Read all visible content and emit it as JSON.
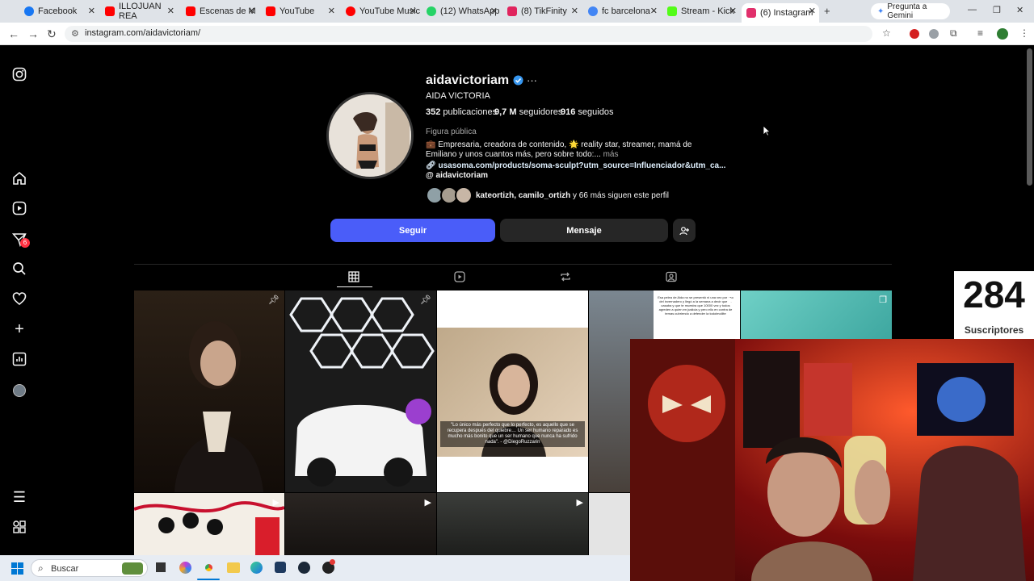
{
  "browser": {
    "tabs": [
      {
        "label": "Facebook",
        "color": "#1877f2"
      },
      {
        "label": "ILLOJUAN REA",
        "color": "#ff0000"
      },
      {
        "label": "Escenas de M",
        "color": "#ff0000"
      },
      {
        "label": "YouTube",
        "color": "#ff0000"
      },
      {
        "label": "YouTube Music",
        "color": "#ff0000"
      },
      {
        "label": "(12) WhatsApp",
        "color": "#25d366"
      },
      {
        "label": "(8) TikFinity",
        "color": "#e0245e"
      },
      {
        "label": "fc barcelona -",
        "color": "#4285f4"
      },
      {
        "label": "Stream - Kick",
        "color": "#53fc18"
      },
      {
        "label": "(6) Instagram",
        "color": "#e1306c"
      }
    ],
    "gemini_label": "Pregunta a Gemini",
    "url": "instagram.com/aidavictoriam/"
  },
  "sidebar": {
    "icons": [
      "instagram-logo-icon",
      "home-icon",
      "reels-icon",
      "messages-icon",
      "search-icon",
      "heart-icon",
      "create-icon",
      "dashboard-icon",
      "profile-avatar-icon",
      "menu-icon",
      "apps-icon"
    ],
    "messages_badge": "6"
  },
  "profile": {
    "username": "aidavictoriam",
    "full_name": "AIDA VICTORIA",
    "posts_count": "352",
    "posts_label": "publicaciones",
    "followers_count": "9,7 M",
    "followers_label": "seguidores",
    "following_count": "916",
    "following_label": "seguidos",
    "category": "Figura pública",
    "bio_line1": "💼 Empresaria, creadora de contenido, 🌟 reality star, streamer, mamá de",
    "bio_line2": "Emiliano y unos cuantos más, pero sobre todo:...",
    "bio_more": "más",
    "link": "usasoma.com/products/soma-sculpt?utm_source=Influenciador&utm_ca...",
    "threads": "aidavictoriam",
    "followed_by_names": "kateortizh, camilo_ortizh",
    "followed_by_rest": "y 66 más siguen este perfil",
    "follow_button": "Seguir",
    "message_button": "Mensaje"
  },
  "posts": {
    "quote_text": "\"Lo único más perfecto que lo perfecto, es aquello que se recupera después del quiebre… Un ser humano reparado es mucho más bonito que un ser humano que nunca ha sufrido nada\". - @DiegoRuzzarin",
    "small_text": "Esa pelea de Aida no se presentó ni una vez por eso del invernadero y llegó a la semana a decir que se casaba y que te muestra que 10000 vez y todos agreden a quien en justicia y pero ello en contra de temas cubriendo a defender la todolmollite"
  },
  "overlay": {
    "subscriber_count": "284",
    "subscriber_label": "Suscriptores"
  },
  "taskbar": {
    "search_placeholder": "Buscar"
  },
  "colors": {
    "follow_blue": "#4a5df9",
    "verified_blue": "#3797f0",
    "link_blue": "#e0f1ff"
  }
}
